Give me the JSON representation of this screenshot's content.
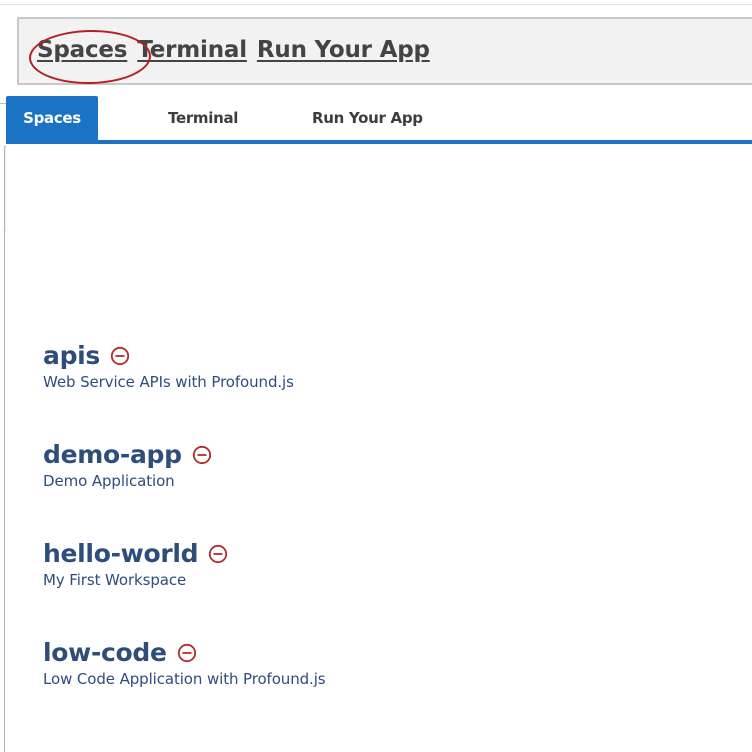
{
  "zoom_callout": {
    "tabs": [
      {
        "label": "Spaces",
        "highlighted": true
      },
      {
        "label": "Terminal"
      },
      {
        "label": "Run Your App"
      }
    ],
    "highlight_color": "#b51f24"
  },
  "app": {
    "tabs": [
      {
        "label": "Spaces",
        "active": true
      },
      {
        "label": "Terminal",
        "active": false
      },
      {
        "label": "Run Your App",
        "active": false
      }
    ],
    "accent_color": "#1a73c4",
    "remove_icon": "minus-circle-icon",
    "remove_icon_color": "#b02d2d",
    "spaces": [
      {
        "name": "apis",
        "description": "Web Service APIs with Profound.js"
      },
      {
        "name": "demo-app",
        "description": "Demo Application"
      },
      {
        "name": "hello-world",
        "description": "My First Workspace"
      },
      {
        "name": "low-code",
        "description": "Low Code Application with Profound.js"
      }
    ]
  }
}
